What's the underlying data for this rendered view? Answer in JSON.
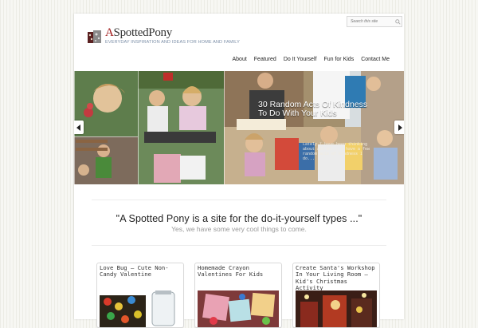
{
  "search": {
    "placeholder": "Search this site"
  },
  "logo": {
    "name_a": "A",
    "name_rest": "Spotted",
    "name_end": "Pony",
    "tagline": "EVERYDAY INSPIRATION AND IDEAS FOR HOME AND FAMILY"
  },
  "nav": {
    "items": [
      "About",
      "Featured",
      "Do It Yourself",
      "Fun for Kids",
      "Contact Me"
    ]
  },
  "slider": {
    "caption": "30 Random Acts Of Kindness To Do With Your Kids",
    "excerpt": "Lately I have been thinking about all of... I have a few random acts of kindness I do..."
  },
  "intro": {
    "title": "\"A Spotted Pony is a site for the do-it-yourself types ...\"",
    "subtitle": "Yes, we have some very cool things to come."
  },
  "posts": [
    {
      "title": "Love Bug – Cute Non-Candy Valentine"
    },
    {
      "title": "Homemade Crayon Valentines For Kids"
    },
    {
      "title": "Create Santa's Workshop In Your Living Room – Kid's Christmas Activity"
    }
  ],
  "colors": {
    "accent": "#a11a1a",
    "tagline": "#7c8fa8",
    "page_bg": "#f3f3ee"
  }
}
